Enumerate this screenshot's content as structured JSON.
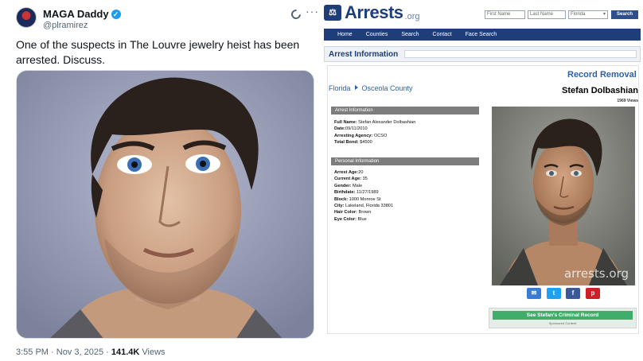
{
  "tweet": {
    "author_name": "MAGA Daddy",
    "handle": "@plramirez",
    "text": "One of the suspects in The Louvre jewelry heist has been arrested. Discuss.",
    "time": "3:55 PM",
    "date": "Nov 3, 2025",
    "views_count": "141.4K",
    "views_label": "Views",
    "icons": {
      "verified": "verified-badge-icon",
      "grok": "grok-icon",
      "more": "more-icon"
    },
    "colors": {
      "verified": "#1d9bf0",
      "text": "#0f1419",
      "muted": "#536471"
    }
  },
  "site": {
    "logo_text": "Arrests",
    "logo_suffix": ".org",
    "search": {
      "first_placeholder": "First Name",
      "last_placeholder": "Last Name",
      "state_value": "Florida",
      "button_label": "Search"
    },
    "nav": [
      "Home",
      "Counties",
      "Search",
      "Contact",
      "Face Search"
    ],
    "section_title": "Arrest Information",
    "record_removal": "Record Removal",
    "breadcrumb": {
      "state": "Florida",
      "county": "Osceola County"
    },
    "person_name": "Stefan Dolbashian",
    "views": "1969 Views",
    "arrest_info_header": "Arrest Information",
    "arrest_fields": [
      {
        "label": "Full Name:",
        "value": "Stefan Alexander Dolbashian"
      },
      {
        "label": "Date:",
        "value": "09/11/2010"
      },
      {
        "label": "Arresting Agency:",
        "value": "OCSO"
      },
      {
        "label": "Total Bond:",
        "value": "$4500"
      }
    ],
    "personal_info_header": "Personal Information",
    "personal_fields": [
      {
        "label": "Arrest Age:",
        "value": "20"
      },
      {
        "label": "Current Age:",
        "value": "35"
      },
      {
        "label": "Gender:",
        "value": "Male"
      },
      {
        "label": "Birthdate:",
        "value": "11/27/1989"
      },
      {
        "label": "Block:",
        "value": "1000 Monroe St"
      },
      {
        "label": "City:",
        "value": "Lakeland, Florida 33801"
      },
      {
        "label": "Hair Color:",
        "value": "Brown"
      },
      {
        "label": "Eye Color:",
        "value": "Blue"
      }
    ],
    "watermark": "arrests.org",
    "share_icons": [
      "mail-icon",
      "twitter-icon",
      "facebook-icon",
      "pinterest-icon"
    ],
    "cta_label": "See Stefan's Criminal Record",
    "cta_sub": "Sponsored Content",
    "colors": {
      "navy": "#1f3d78",
      "link": "#2d5fa7",
      "green": "#3fae6b",
      "grey_bar": "#7d7d7d"
    }
  }
}
